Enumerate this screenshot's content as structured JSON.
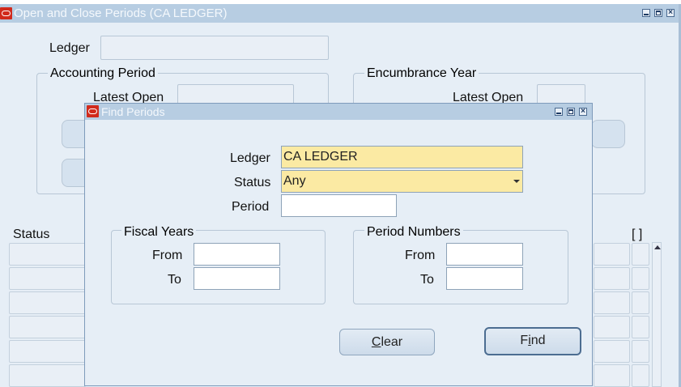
{
  "main_window": {
    "title": "Open and Close Periods (CA LEDGER)",
    "ledger_label": "Ledger",
    "accounting_period_group": "Accounting Period",
    "encumbrance_year_group": "Encumbrance Year",
    "latest_open_label": "Latest Open",
    "status_column": "Status",
    "bracket_column": "[ ]"
  },
  "find_dialog": {
    "title": "Find Periods",
    "ledger_label": "Ledger",
    "ledger_value": "CA LEDGER",
    "status_label": "Status",
    "status_value": "Any",
    "period_label": "Period",
    "period_value": "",
    "fiscal_years_group": "Fiscal Years",
    "period_numbers_group": "Period Numbers",
    "from_label": "From",
    "to_label": "To",
    "clear_button": {
      "mnemonic": "C",
      "rest": "lear"
    },
    "find_button": {
      "pre": "F",
      "mnemonic": "i",
      "rest": "nd"
    }
  },
  "colors": {
    "titlebar": "#b7cde2",
    "canvas": "#e6eef6",
    "required_field": "#fbeaa3",
    "oracle_icon": "#d12a1c"
  },
  "icons": [
    "oracle-logo-icon",
    "minimize-icon",
    "maximize-icon",
    "close-icon",
    "dropdown-caret-icon",
    "scroll-up-arrow-icon"
  ]
}
